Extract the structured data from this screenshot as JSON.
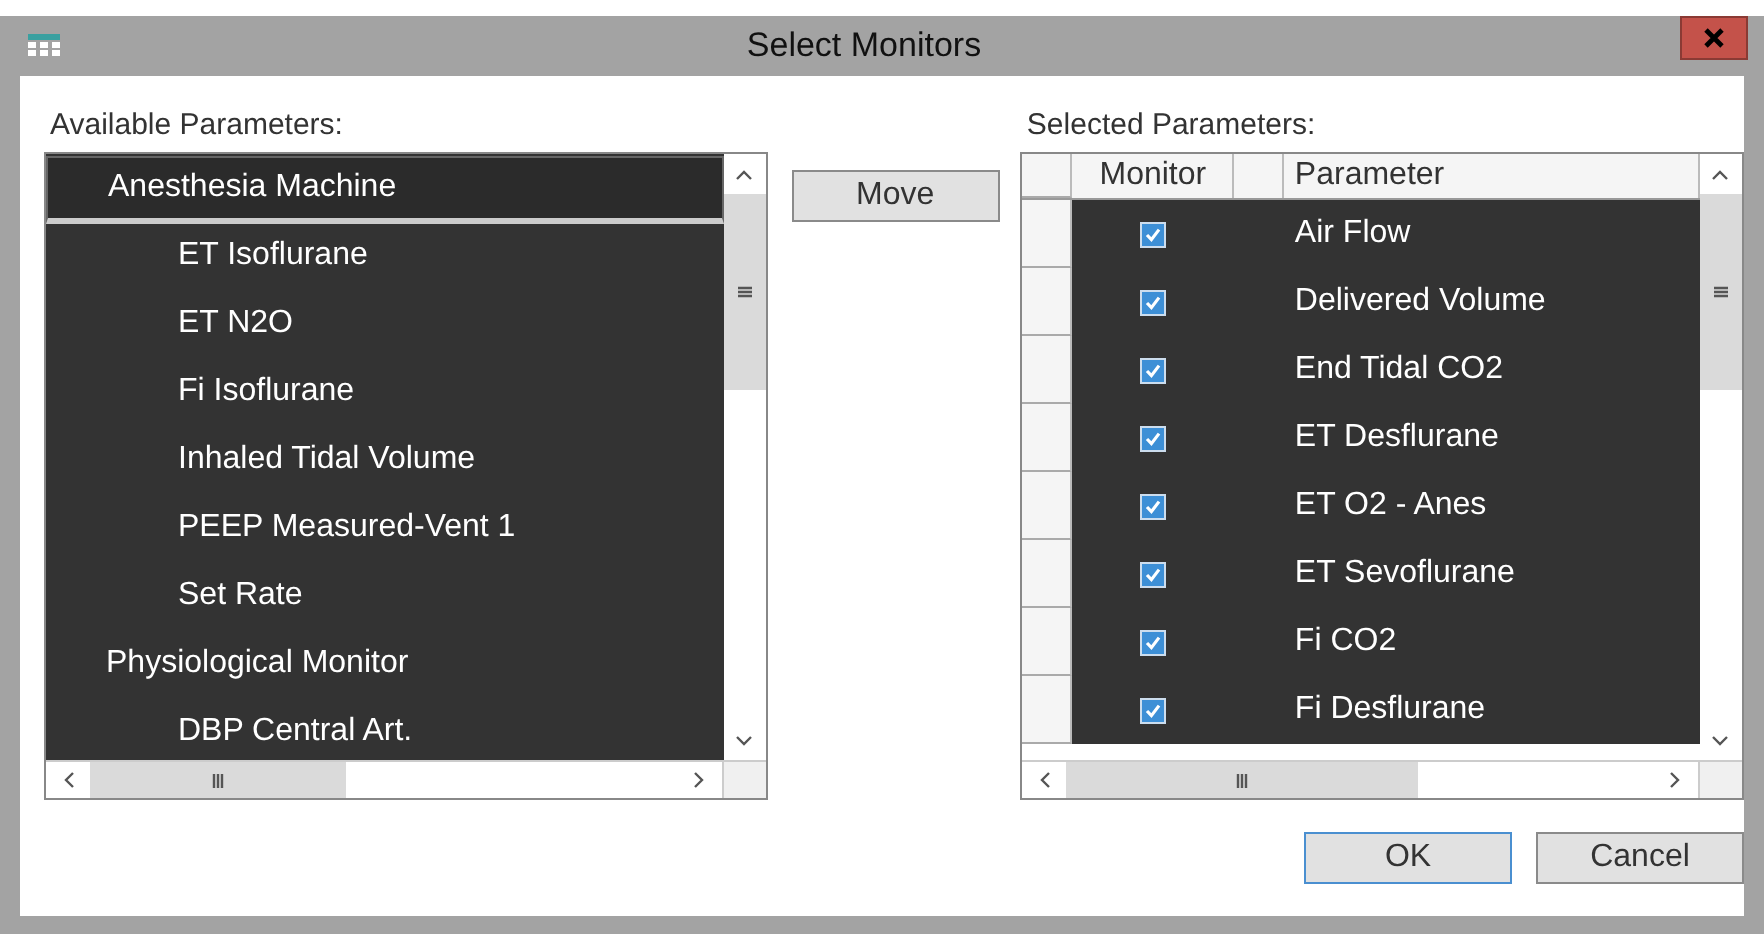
{
  "window": {
    "title": "Select Monitors"
  },
  "available": {
    "label": "Available Parameters:",
    "items": [
      {
        "label": "Anesthesia Machine",
        "selected": true,
        "children": [
          {
            "label": "ET Isoflurane",
            "selected": false
          },
          {
            "label": "ET N2O",
            "selected": false
          },
          {
            "label": "Fi Isoflurane",
            "selected": false
          },
          {
            "label": "Inhaled Tidal Volume",
            "selected": false
          },
          {
            "label": "PEEP Measured-Vent 1",
            "selected": false
          },
          {
            "label": "Set Rate",
            "selected": false
          }
        ]
      },
      {
        "label": "Physiological Monitor",
        "selected": false,
        "children": [
          {
            "label": "DBP Central Art.",
            "selected": false
          }
        ]
      }
    ]
  },
  "move_button": "Move",
  "selected_params": {
    "label": "Selected Parameters:",
    "columns": [
      "Monitor",
      "Parameter"
    ],
    "rows": [
      {
        "monitor": true,
        "parameter": "Air Flow"
      },
      {
        "monitor": true,
        "parameter": "Delivered Volume"
      },
      {
        "monitor": true,
        "parameter": "End Tidal CO2"
      },
      {
        "monitor": true,
        "parameter": "ET Desflurane"
      },
      {
        "monitor": true,
        "parameter": "ET O2 - Anes"
      },
      {
        "monitor": true,
        "parameter": "ET Sevoflurane"
      },
      {
        "monitor": true,
        "parameter": "Fi CO2"
      },
      {
        "monitor": true,
        "parameter": "Fi Desflurane"
      }
    ]
  },
  "buttons": [
    "OK",
    "Cancel"
  ]
}
